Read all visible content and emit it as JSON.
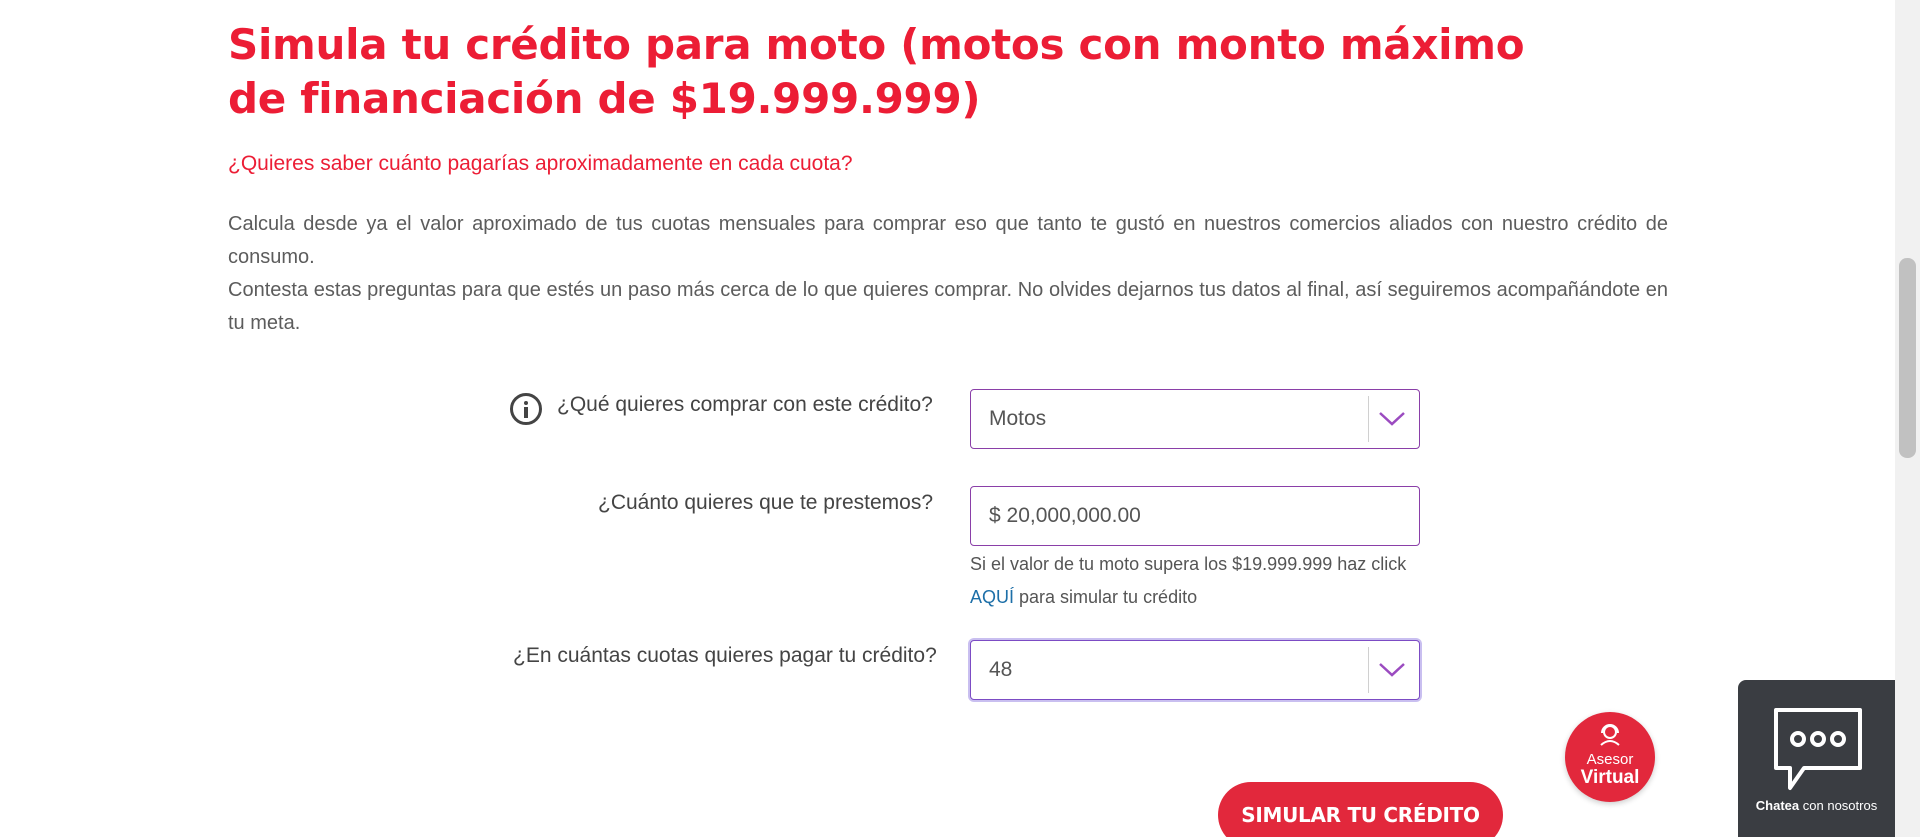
{
  "page": {
    "title": "Simula tu crédito para moto (motos con monto máximo de financiación de $19.999.999)",
    "subtitle": "¿Quieres saber cuánto pagarías aproximadamente en cada cuota?",
    "paragraph_1": "Calcula desde ya el valor aproximado de tus cuotas mensuales para comprar eso que tanto te gustó en nuestros comercios aliados con nuestro crédito de consumo.",
    "paragraph_2": "Contesta estas preguntas para que estés un paso más cerca de lo que quieres comprar. No olvides dejarnos tus datos al final, así seguiremos acompañándote en tu meta."
  },
  "form": {
    "q1": {
      "label": "¿Qué quieres comprar con este crédito?",
      "value": "Motos",
      "icon": "info-icon"
    },
    "q2": {
      "label": "¿Cuánto quieres que te prestemos?",
      "value": "$ 20,000,000.00",
      "hint_text": "Si el valor de tu moto supera los $19.999.999 haz click",
      "hint_link": "AQUÍ",
      "hint_suffix": " para simular tu crédito"
    },
    "q3": {
      "label": "¿En cuántas cuotas quieres pagar tu crédito?",
      "value": "48"
    },
    "submit_label": "SIMULAR TU CRÉDITO"
  },
  "widgets": {
    "asesor_line1": "Asesor",
    "asesor_line2": "Virtual",
    "chat_bold": "Chatea",
    "chat_rest": " con nosotros"
  },
  "colors": {
    "brand_red": "#ec1d35",
    "field_border": "#8a3fa8",
    "link_blue": "#1d6fa8",
    "chat_panel": "#3a3d42"
  }
}
